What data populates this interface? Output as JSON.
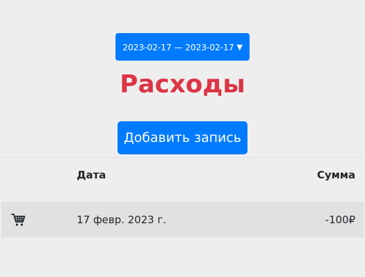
{
  "date_range": {
    "label": "2023-02-17 — 2023-02-17",
    "caret": "▼"
  },
  "title": "Расходы",
  "add_button": "Добавить запись",
  "table": {
    "headers": {
      "date": "Дата",
      "amount": "Сумма"
    },
    "rows": [
      {
        "icon": "shopping-cart-icon",
        "date": "17 февр. 2023 г.",
        "amount": "-100₽"
      }
    ]
  },
  "colors": {
    "primary": "#007bff",
    "title": "#dc3545",
    "background": "#eeeeee",
    "row_background": "#e1e1e1"
  }
}
